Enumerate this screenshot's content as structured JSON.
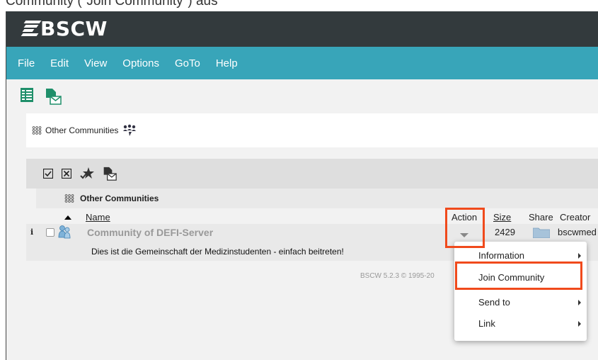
{
  "caption": "Community (\"Join Community\") aus",
  "app": {
    "logo_text": "BSCW"
  },
  "menu": [
    "File",
    "Edit",
    "View",
    "Options",
    "GoTo",
    "Help"
  ],
  "breadcrumb": {
    "label": "Other Communities"
  },
  "list": {
    "folder_title": "Other Communities",
    "columns": {
      "name": "Name",
      "action": "Action",
      "size": "Size",
      "share": "Share",
      "creator": "Creator"
    },
    "rows": [
      {
        "name": "Community of DEFI-Server",
        "description": "Dies ist die Gemeinschaft der Medizinstudenten - einfach beitreten!",
        "size": "2429",
        "creator": "bscwmed"
      }
    ]
  },
  "footer": "BSCW 5.2.3 © 1995-20",
  "context_menu": {
    "items": [
      {
        "label": "Information",
        "submenu": true
      },
      {
        "label": "Join Community",
        "submenu": false
      },
      {
        "label": "Send to",
        "submenu": true
      },
      {
        "label": "Link",
        "submenu": true
      }
    ]
  },
  "colors": {
    "brand_bar": "#333a3d",
    "menu_bar": "#38a5b9",
    "highlight": "#f04a1c",
    "icon_green": "#1f8f6a"
  }
}
